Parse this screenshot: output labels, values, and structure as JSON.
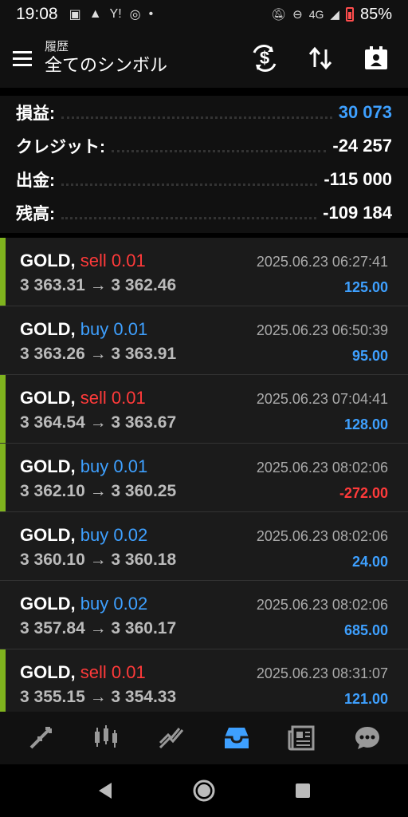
{
  "status": {
    "time": "19:08",
    "network": "4G",
    "battery": "85%"
  },
  "header": {
    "subtitle": "履歴",
    "title": "全てのシンボル",
    "icons": [
      "menu-icon",
      "currency-exchange-icon",
      "sort-icon",
      "calendar-icon"
    ]
  },
  "summary": {
    "rows": [
      {
        "label": "損益:",
        "value": "30 073"
      },
      {
        "label": "クレジット:",
        "value": "-24 257"
      },
      {
        "label": "出金:",
        "value": "-115 000"
      },
      {
        "label": "残高:",
        "value": "-109 184"
      }
    ]
  },
  "trades": [
    {
      "symbol": "GOLD,",
      "side": "sell 0.01",
      "prices": "3 363.31 → 3 362.46",
      "date": "2025.06.23 06:27:41",
      "pl": "125.00"
    },
    {
      "symbol": "GOLD,",
      "side": "buy 0.01",
      "prices": "3 363.26 → 3 363.91",
      "date": "2025.06.23 06:50:39",
      "pl": "95.00"
    },
    {
      "symbol": "GOLD,",
      "side": "sell 0.01",
      "prices": "3 364.54 → 3 363.67",
      "date": "2025.06.23 07:04:41",
      "pl": "128.00"
    },
    {
      "symbol": "GOLD,",
      "side": "buy 0.01",
      "prices": "3 362.10 → 3 360.25",
      "date": "2025.06.23 08:02:06",
      "pl": "-272.00"
    },
    {
      "symbol": "GOLD,",
      "side": "buy 0.02",
      "prices": "3 360.10 → 3 360.18",
      "date": "2025.06.23 08:02:06",
      "pl": "24.00"
    },
    {
      "symbol": "GOLD,",
      "side": "buy 0.02",
      "prices": "3 357.84 → 3 360.17",
      "date": "2025.06.23 08:02:06",
      "pl": "685.00"
    },
    {
      "symbol": "GOLD,",
      "side": "sell 0.01",
      "prices": "3 355.15 → 3 354.33",
      "date": "2025.06.23 08:31:07",
      "pl": "121.00"
    }
  ],
  "tabs": [
    "quotes-icon",
    "chart-icon",
    "trade-icon",
    "history-icon",
    "news-icon",
    "chat-icon"
  ],
  "colors": {
    "accent": "#3ea0ff",
    "loss": "#ff3a3a",
    "sell_marker": "#7fb31e"
  }
}
